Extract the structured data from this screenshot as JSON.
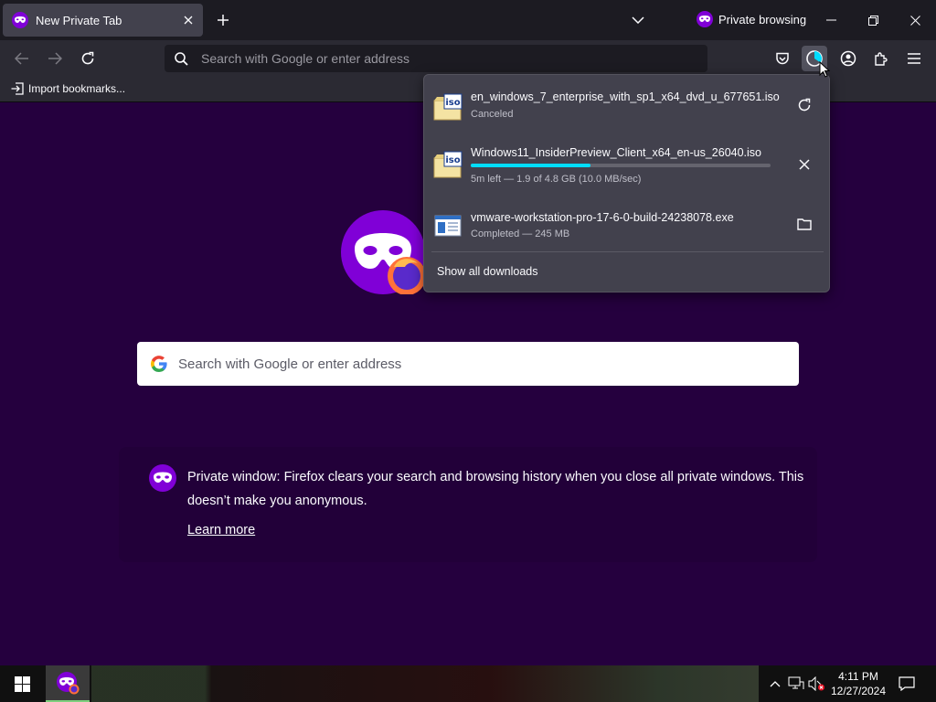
{
  "tab": {
    "title": "New Private Tab"
  },
  "private_indicator": {
    "label": "Private browsing"
  },
  "urlbar": {
    "placeholder": "Search with Google or enter address"
  },
  "bookmarks": {
    "import_label": "Import bookmarks..."
  },
  "search": {
    "placeholder": "Search with Google or enter address"
  },
  "private_message": {
    "text": "Private window: Firefox clears your search and browsing history when you close all private windows. This doesn’t make you anonymous.",
    "learn_more": "Learn more"
  },
  "downloads": {
    "items": [
      {
        "filename": "en_windows_7_enterprise_with_sp1_x64_dvd_u_677651.iso",
        "status": "Canceled",
        "file_icon": "iso-file-icon",
        "action_icon": "retry-icon"
      },
      {
        "filename": "Windows11_InsiderPreview_Client_x64_en-us_26040.iso",
        "status": "5m left — 1.9 of 4.8 GB (10.0 MB/sec)",
        "progress": 0.4,
        "file_icon": "iso-file-icon",
        "action_icon": "cancel-icon"
      },
      {
        "filename": "vmware-workstation-pro-17-6-0-build-24238078.exe",
        "status": "Completed — 245 MB",
        "file_icon": "exe-file-icon",
        "action_icon": "folder-icon"
      }
    ],
    "show_all_label": "Show all downloads"
  },
  "taskbar": {
    "time": "4:11 PM",
    "date": "12/27/2024"
  },
  "colors": {
    "private_purple": "#25003e",
    "progress_accent": "#00ddff",
    "mask_purple": "#8000d7"
  }
}
